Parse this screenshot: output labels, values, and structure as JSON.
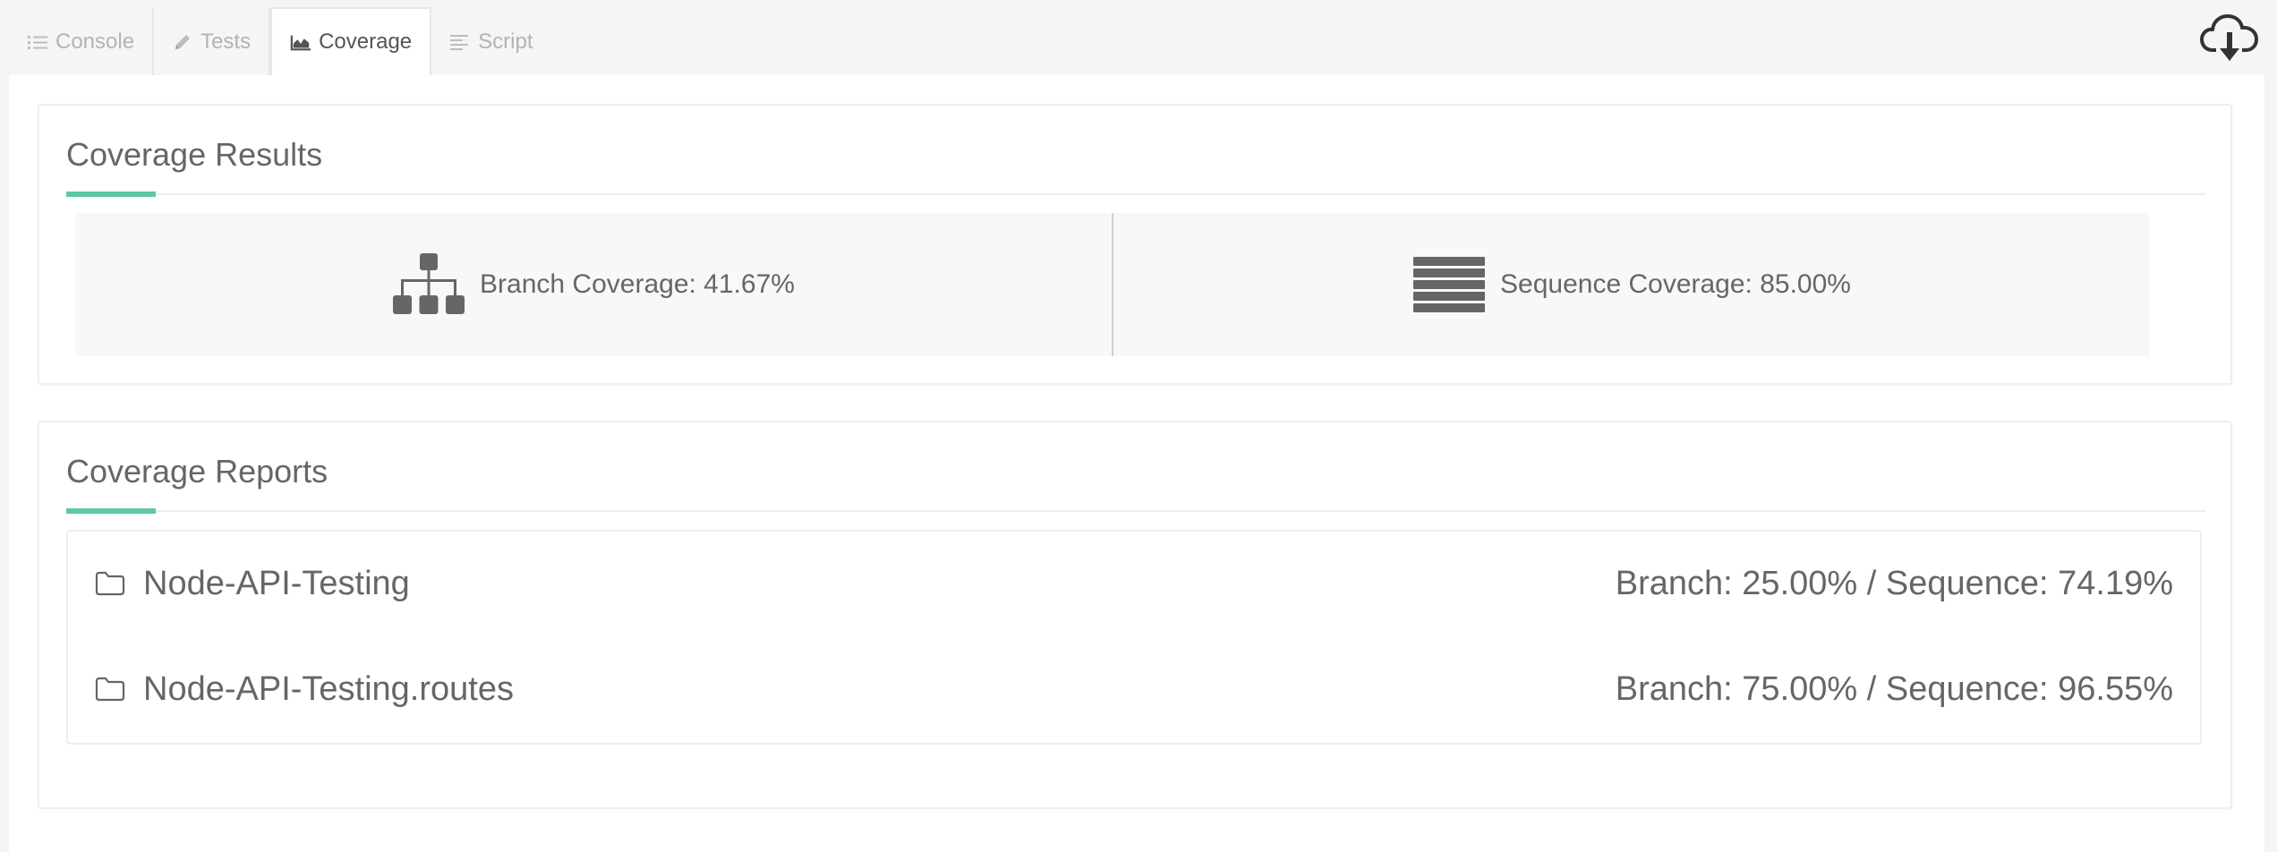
{
  "tabs": [
    {
      "label": "Console",
      "icon": "list-icon",
      "active": false
    },
    {
      "label": "Tests",
      "icon": "pencil-icon",
      "active": false
    },
    {
      "label": "Coverage",
      "icon": "area-chart-icon",
      "active": true
    },
    {
      "label": "Script",
      "icon": "align-left-icon",
      "active": false
    }
  ],
  "toolbar": {
    "download_icon": "cloud-download-icon"
  },
  "results": {
    "title": "Coverage Results",
    "branch": {
      "label": "Branch Coverage: 41.67%",
      "icon": "sitemap-icon",
      "value": 41.67
    },
    "sequence": {
      "label": "Sequence Coverage: 85.00%",
      "icon": "stack-icon",
      "value": 85.0
    }
  },
  "reports": {
    "title": "Coverage Reports",
    "items": [
      {
        "name": "Node-API-Testing",
        "stats": "Branch: 25.00% / Sequence: 74.19%",
        "icon": "folder-icon"
      },
      {
        "name": "Node-API-Testing.routes",
        "stats": "Branch: 75.00% / Sequence: 96.55%",
        "icon": "folder-icon"
      }
    ]
  },
  "colors": {
    "accent": "#5dc7a6",
    "text": "#666666",
    "muted": "#b3b3b3"
  }
}
